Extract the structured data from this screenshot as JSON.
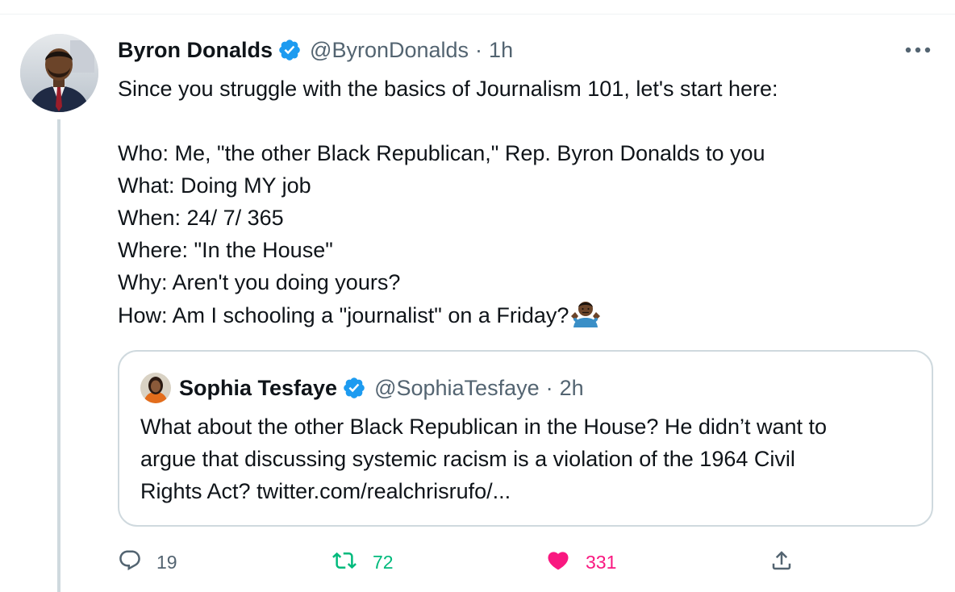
{
  "colors": {
    "text": "#0f1419",
    "secondary": "#536471",
    "verified": "#1d9bf0",
    "retweet": "#00ba7c",
    "like": "#f91880",
    "border": "#cfd9de"
  },
  "tweet": {
    "author": {
      "name": "Byron Donalds",
      "handle": "@ByronDonalds",
      "separator": "·",
      "time": "1h",
      "verified": true,
      "avatar_icon": "profile-photo"
    },
    "text_lines": [
      "Since you struggle with the basics of Journalism 101, let's start here:",
      "",
      "Who: Me, \"the other Black Republican,\" Rep. Byron Donalds to you",
      "What: Doing MY job",
      "When: 24/ 7/ 365",
      "Where: \"In the House\"",
      "Why: Aren't you doing yours?",
      "How: Am I schooling a \"journalist\" on a Friday?"
    ],
    "emoji": "man-shrugging-emoji",
    "more_icon": "more-icon"
  },
  "quote": {
    "author": {
      "name": "Sophia Tesfaye",
      "handle": "@SophiaTesfaye",
      "separator": "·",
      "time": "2h",
      "verified": true
    },
    "text_lines": [
      "What about the other Black Republican in the House? He didn’t want to",
      "argue that discussing systemic racism is a violation of the 1964 Civil",
      "Rights Act? twitter.com/realchrisrufo/..."
    ]
  },
  "actions": {
    "reply": {
      "icon": "reply-icon",
      "count": "19"
    },
    "retweet": {
      "icon": "retweet-icon",
      "count": "72",
      "active": true
    },
    "like": {
      "icon": "heart-icon",
      "count": "331",
      "active": true
    },
    "share": {
      "icon": "share-icon"
    }
  }
}
